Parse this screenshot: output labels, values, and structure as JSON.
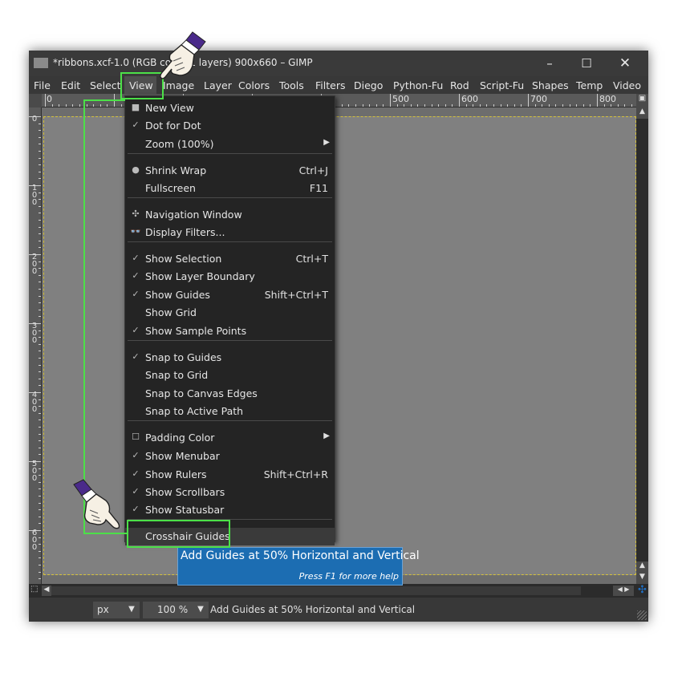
{
  "window": {
    "title": "*ribbons.xcf-1.0 (RGB color, 1 layers) 900x660 – GIMP",
    "minimize_glyph": "–",
    "maximize_glyph": "☐",
    "close_glyph": "✕"
  },
  "menubar": {
    "items": [
      "File",
      "Edit",
      "Select",
      "View",
      "Image",
      "Layer",
      "Colors",
      "Tools",
      "Filters",
      "Diego",
      "Python-Fu",
      "Rod",
      "Script-Fu",
      "Shapes",
      "Temp",
      "Video"
    ]
  },
  "rulers": {
    "top_labels": [
      "0",
      "1",
      "500",
      "600",
      "700",
      "800"
    ],
    "left_labels": [
      "0",
      "100",
      "200",
      "300",
      "400",
      "500",
      "600"
    ]
  },
  "view_menu": {
    "items": [
      {
        "label": "New View",
        "icon": "new-view-icon",
        "glyph": "■"
      },
      {
        "label": "Dot for Dot",
        "icon": "check-icon",
        "glyph": "✓"
      },
      {
        "label": "Zoom (100%)",
        "submenu": true
      },
      {
        "label": "Shrink Wrap",
        "accel": "Ctrl+J",
        "icon": "shrink-wrap-icon",
        "glyph": "●"
      },
      {
        "label": "Fullscreen",
        "accel": "F11"
      },
      {
        "label": "Navigation Window",
        "icon": "navigation-icon",
        "glyph": "✣"
      },
      {
        "label": "Display Filters...",
        "icon": "glasses-icon",
        "glyph": "👓"
      },
      {
        "label": "Show Selection",
        "accel": "Ctrl+T",
        "glyph": "✓"
      },
      {
        "label": "Show Layer Boundary",
        "glyph": "✓"
      },
      {
        "label": "Show Guides",
        "accel": "Shift+Ctrl+T",
        "glyph": "✓"
      },
      {
        "label": "Show Grid"
      },
      {
        "label": "Show Sample Points",
        "glyph": "✓"
      },
      {
        "label": "Snap to Guides",
        "glyph": "✓"
      },
      {
        "label": "Snap to Grid"
      },
      {
        "label": "Snap to Canvas Edges"
      },
      {
        "label": "Snap to Active Path"
      },
      {
        "label": "Padding Color",
        "submenu": true,
        "glyph": "☐"
      },
      {
        "label": "Show Menubar",
        "glyph": "✓"
      },
      {
        "label": "Show Rulers",
        "accel": "Shift+Ctrl+R",
        "glyph": "✓"
      },
      {
        "label": "Show Scrollbars",
        "glyph": "✓"
      },
      {
        "label": "Show Statusbar",
        "glyph": "✓"
      },
      {
        "label": "Crosshair Guides"
      }
    ]
  },
  "tooltip": {
    "main": "Add Guides at 50% Horizontal and Vertical",
    "help": "Press F1 for more help"
  },
  "statusbar": {
    "unit": "px",
    "zoom": "100 %",
    "message": "Add Guides at 50% Horizontal and Vertical"
  },
  "colors": {
    "highlight_green": "#4ce048",
    "tooltip_blue": "#1c6db2",
    "guide_yellow": "#d6c23a"
  }
}
